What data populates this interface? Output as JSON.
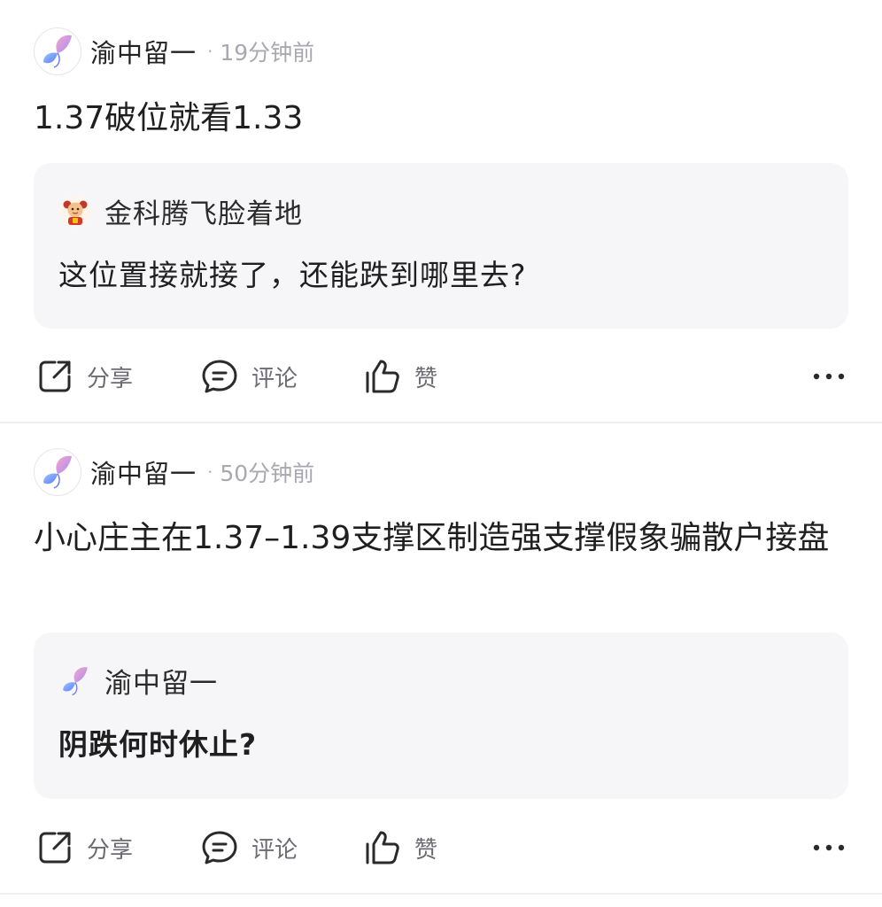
{
  "posts": [
    {
      "author": "渝中留一",
      "separator": "·",
      "time": "19分钟前",
      "content": "1.37破位就看1.33",
      "quote": {
        "author": "金科腾飞脸着地",
        "text": "这位置接就接了，还能跌到哪里去?"
      },
      "actions": {
        "share": "分享",
        "comment": "评论",
        "like": "赞"
      }
    },
    {
      "author": "渝中留一",
      "separator": "·",
      "time": "50分钟前",
      "content": "小心庄主在1.37–1.39支撑区制造强支撑假象骗散户接盘",
      "quote": {
        "author": "渝中留一",
        "text": "阴跌何时休止?"
      },
      "actions": {
        "share": "分享",
        "comment": "评论",
        "like": "赞"
      }
    }
  ],
  "icons": {
    "avatar": "butterfly-icon",
    "quote_avatar_1": "cartoon-character-icon",
    "share": "share-icon",
    "comment": "comment-icon",
    "like": "thumbs-up-icon",
    "more": "more-dots-icon"
  },
  "colors": {
    "quote_background": "#f6f6f8",
    "divider": "#efeff1",
    "meta_text": "#a8a8b0",
    "action_text": "#6b6b73"
  }
}
